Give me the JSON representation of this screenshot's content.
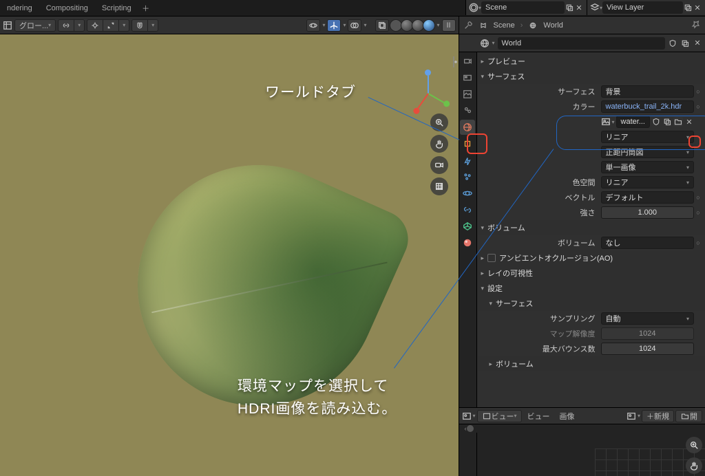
{
  "tabs": [
    "ndering",
    "Compositing",
    "Scripting"
  ],
  "scene": {
    "label": "Scene",
    "view_layer": "View Layer"
  },
  "vp_toolbar": {
    "mode_label": "グロー..."
  },
  "props_header": {
    "scene": "Scene",
    "world": "World"
  },
  "world_row": {
    "world_label": "World"
  },
  "panels": {
    "preview": "プレビュー",
    "surface": "サーフェス",
    "volume": "ボリューム",
    "ao": "アンビエントオクルージョン(AO)",
    "ray_vis": "レイの可視性",
    "settings": "設定",
    "sub_surface": "サーフェス",
    "sub_volume": "ボリューム"
  },
  "surface": {
    "surface_label": "サーフェス",
    "surface_value": "背景",
    "color_label": "カラー",
    "color_value": "waterbuck_trail_2k.hdr",
    "image_short": "water...",
    "linear": "リニア",
    "projection": "正距円筒図",
    "single_image": "単一画像",
    "colorspace_label": "色空間",
    "colorspace_value": "リニア",
    "vector_label": "ベクトル",
    "vector_value": "デフォルト",
    "strength_label": "強さ",
    "strength_value": "1.000"
  },
  "volume": {
    "label": "ボリューム",
    "value": "なし"
  },
  "settings": {
    "sampling_label": "サンプリング",
    "sampling_value": "自動",
    "map_res_label": "マップ解像度",
    "map_res_value": "1024",
    "max_bounce_label": "最大バウンス数",
    "max_bounce_value": "1024"
  },
  "bottom": {
    "view_dropdown": "ビュー",
    "view": "ビュー",
    "image": "画像",
    "new": "新規",
    "open": "開"
  },
  "annotations": {
    "world_tab": "ワールドタブ",
    "hdri_line1": "環境マップを選択して",
    "hdri_line2": "HDRI画像を読み込む。"
  }
}
